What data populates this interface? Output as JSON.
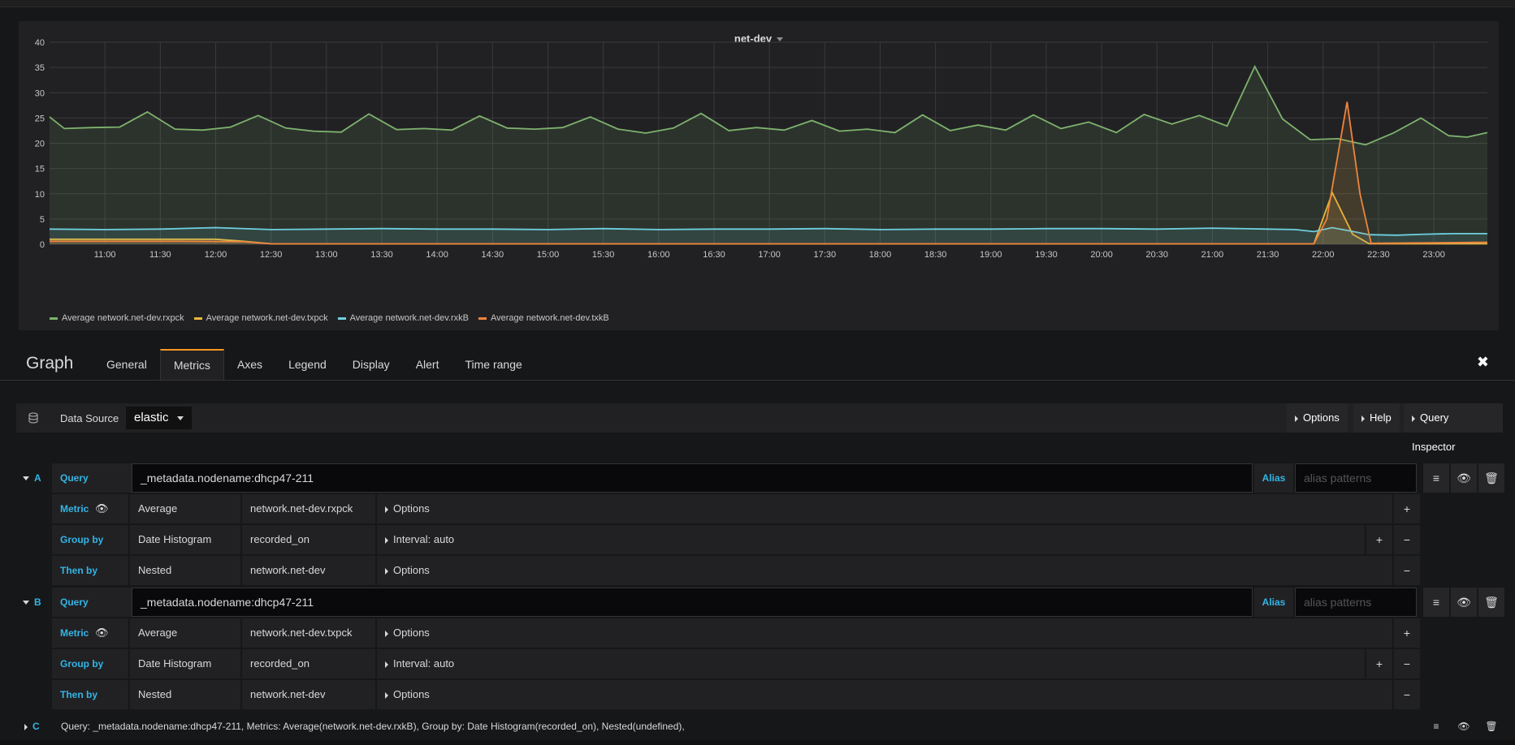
{
  "panel": {
    "title": "net-dev"
  },
  "chart_data": {
    "type": "line",
    "ylim": [
      0,
      40
    ],
    "yticks": [
      "0",
      "5",
      "10",
      "15",
      "20",
      "25",
      "30",
      "35",
      "40"
    ],
    "xticks": [
      "11:00",
      "11:30",
      "12:00",
      "12:30",
      "13:00",
      "13:30",
      "14:00",
      "14:30",
      "15:00",
      "15:30",
      "16:00",
      "16:30",
      "17:00",
      "17:30",
      "18:00",
      "18:30",
      "19:00",
      "19:30",
      "20:00",
      "20:30",
      "21:00",
      "21:30",
      "22:00",
      "22:30",
      "23:00"
    ],
    "x_range_minutes": [
      630,
      1409
    ],
    "series": [
      {
        "name": "Average network.net-dev.rxpck",
        "color": "#7eb26d",
        "x": [
          630,
          638,
          653,
          668,
          683,
          698,
          713,
          728,
          743,
          758,
          773,
          788,
          803,
          818,
          833,
          848,
          863,
          878,
          893,
          908,
          923,
          938,
          953,
          968,
          983,
          998,
          1013,
          1028,
          1043,
          1058,
          1073,
          1088,
          1103,
          1118,
          1133,
          1148,
          1163,
          1178,
          1193,
          1208,
          1223,
          1238,
          1253,
          1268,
          1283,
          1298,
          1313,
          1328,
          1343,
          1358,
          1373,
          1388,
          1398,
          1409
        ],
        "values": [
          25.2,
          22.9,
          23.1,
          23.2,
          26.2,
          22.8,
          22.6,
          23.2,
          25.5,
          23.0,
          22.4,
          22.2,
          25.8,
          22.7,
          22.9,
          22.6,
          25.4,
          23.0,
          22.8,
          23.1,
          25.2,
          22.8,
          22.0,
          23.0,
          25.9,
          22.5,
          23.1,
          22.6,
          24.5,
          22.4,
          22.8,
          22.1,
          25.6,
          22.5,
          23.6,
          22.6,
          25.6,
          22.9,
          24.2,
          22.1,
          25.7,
          23.8,
          25.5,
          23.4,
          35.2,
          24.8,
          20.7,
          20.9,
          19.7,
          22.0,
          25.0,
          21.5,
          21.2,
          22.1
        ]
      },
      {
        "name": "Average network.net-dev.txpck",
        "color": "#eab839",
        "x": [
          630,
          660,
          690,
          720,
          735,
          750,
          1300,
          1315,
          1325,
          1336,
          1345,
          1409
        ],
        "values": [
          1.0,
          1.0,
          1.0,
          1.0,
          0.6,
          0.1,
          0.1,
          0.1,
          10.2,
          2.0,
          0.1,
          0.1
        ]
      },
      {
        "name": "Average network.net-dev.rxkB",
        "color": "#6ed0e0",
        "x": [
          630,
          660,
          690,
          720,
          750,
          780,
          810,
          840,
          870,
          900,
          930,
          960,
          990,
          1020,
          1050,
          1080,
          1110,
          1140,
          1170,
          1200,
          1230,
          1260,
          1290,
          1305,
          1315,
          1325,
          1335,
          1345,
          1360,
          1375,
          1390,
          1409
        ],
        "values": [
          3.0,
          2.9,
          3.0,
          3.3,
          2.9,
          3.0,
          3.1,
          3.0,
          3.0,
          2.9,
          3.1,
          2.9,
          3.0,
          3.0,
          3.1,
          2.9,
          3.0,
          3.0,
          3.1,
          3.1,
          3.0,
          3.2,
          3.0,
          2.9,
          2.5,
          3.3,
          2.6,
          1.9,
          1.8,
          2.0,
          2.1,
          2.1
        ]
      },
      {
        "name": "Average network.net-dev.txkB",
        "color": "#ef843c",
        "x": [
          630,
          700,
          735,
          750,
          1300,
          1315,
          1322,
          1333,
          1340,
          1346,
          1409
        ],
        "values": [
          0.6,
          0.6,
          0.5,
          0.1,
          0.1,
          0.1,
          5.0,
          28.2,
          10.0,
          0.2,
          0.4
        ]
      }
    ]
  },
  "editor": {
    "title": "Graph",
    "tabs": [
      "General",
      "Metrics",
      "Axes",
      "Legend",
      "Display",
      "Alert",
      "Time range"
    ],
    "active_tab": "Metrics",
    "datasource_label": "Data Source",
    "datasource_value": "elastic",
    "options_btn": "Options",
    "help_btn": "Help",
    "inspector_btn": "Query Inspector"
  },
  "queries": [
    {
      "ref": "A",
      "query_label": "Query",
      "query": "_metadata.nodename:dhcp47-211",
      "alias_label": "Alias",
      "alias_placeholder": "alias patterns",
      "metric_label": "Metric",
      "metric_type": "Average",
      "metric_field": "network.net-dev.rxpck",
      "metric_options": "Options",
      "groupby_label": "Group by",
      "groupby_type": "Date Histogram",
      "groupby_field": "recorded_on",
      "groupby_options": "Interval: auto",
      "thenby_label": "Then by",
      "thenby_type": "Nested",
      "thenby_field": "network.net-dev",
      "thenby_options": "Options"
    },
    {
      "ref": "B",
      "query_label": "Query",
      "query": "_metadata.nodename:dhcp47-211",
      "alias_label": "Alias",
      "alias_placeholder": "alias patterns",
      "metric_label": "Metric",
      "metric_type": "Average",
      "metric_field": "network.net-dev.txpck",
      "metric_options": "Options",
      "groupby_label": "Group by",
      "groupby_type": "Date Histogram",
      "groupby_field": "recorded_on",
      "groupby_options": "Interval: auto",
      "thenby_label": "Then by",
      "thenby_type": "Nested",
      "thenby_field": "network.net-dev",
      "thenby_options": "Options"
    }
  ],
  "query_c": {
    "ref": "C",
    "summary": "Query: _metadata.nodename:dhcp47-211, Metrics: Average(network.net-dev.rxkB), Group by: Date Histogram(recorded_on), Nested(undefined),"
  }
}
